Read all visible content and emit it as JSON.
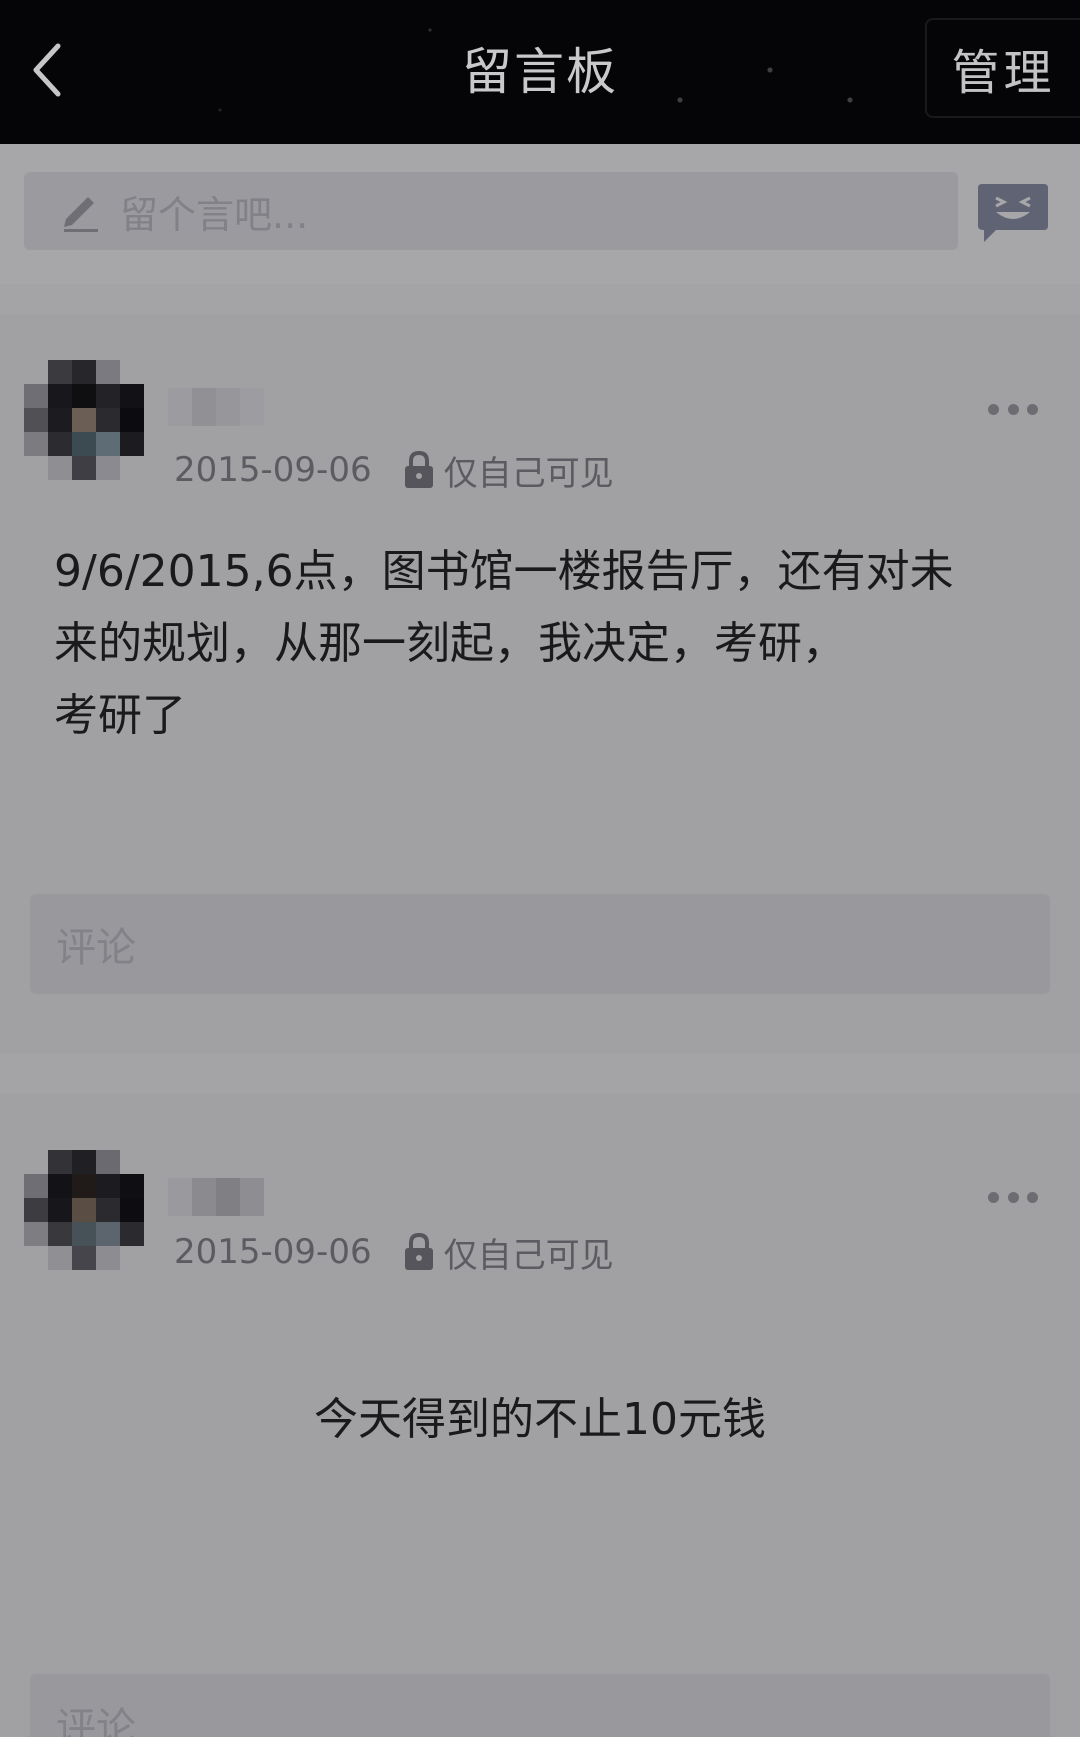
{
  "header": {
    "title": "留言板",
    "manage_label": "管理"
  },
  "composer": {
    "placeholder": "留个言吧..."
  },
  "posts": [
    {
      "date": "2015-09-06",
      "visibility": "仅自己可见",
      "content_lines": [
        "9/6/2015,6点，图书馆一楼报告厅，还有对未",
        "来的规划，从那一刻起，我决定，考研，",
        "考研了"
      ],
      "comment_placeholder": "评论"
    },
    {
      "date": "2015-09-06",
      "visibility": "仅自己可见",
      "content_lines": [
        "今天得到的不止10元钱"
      ],
      "comment_placeholder": "评论"
    }
  ],
  "colors": {
    "header_bg": "#050507",
    "page_bg": "#a4a4a7",
    "text_dark": "#1a1a1c",
    "meta_text": "#5b5b61",
    "emoji_button": "#5f6374"
  },
  "icons": {
    "back": "chevron-left-icon",
    "pen": "pencil-icon",
    "emoji": "emoji-icon",
    "more": "more-dots-icon",
    "lock": "lock-icon"
  }
}
